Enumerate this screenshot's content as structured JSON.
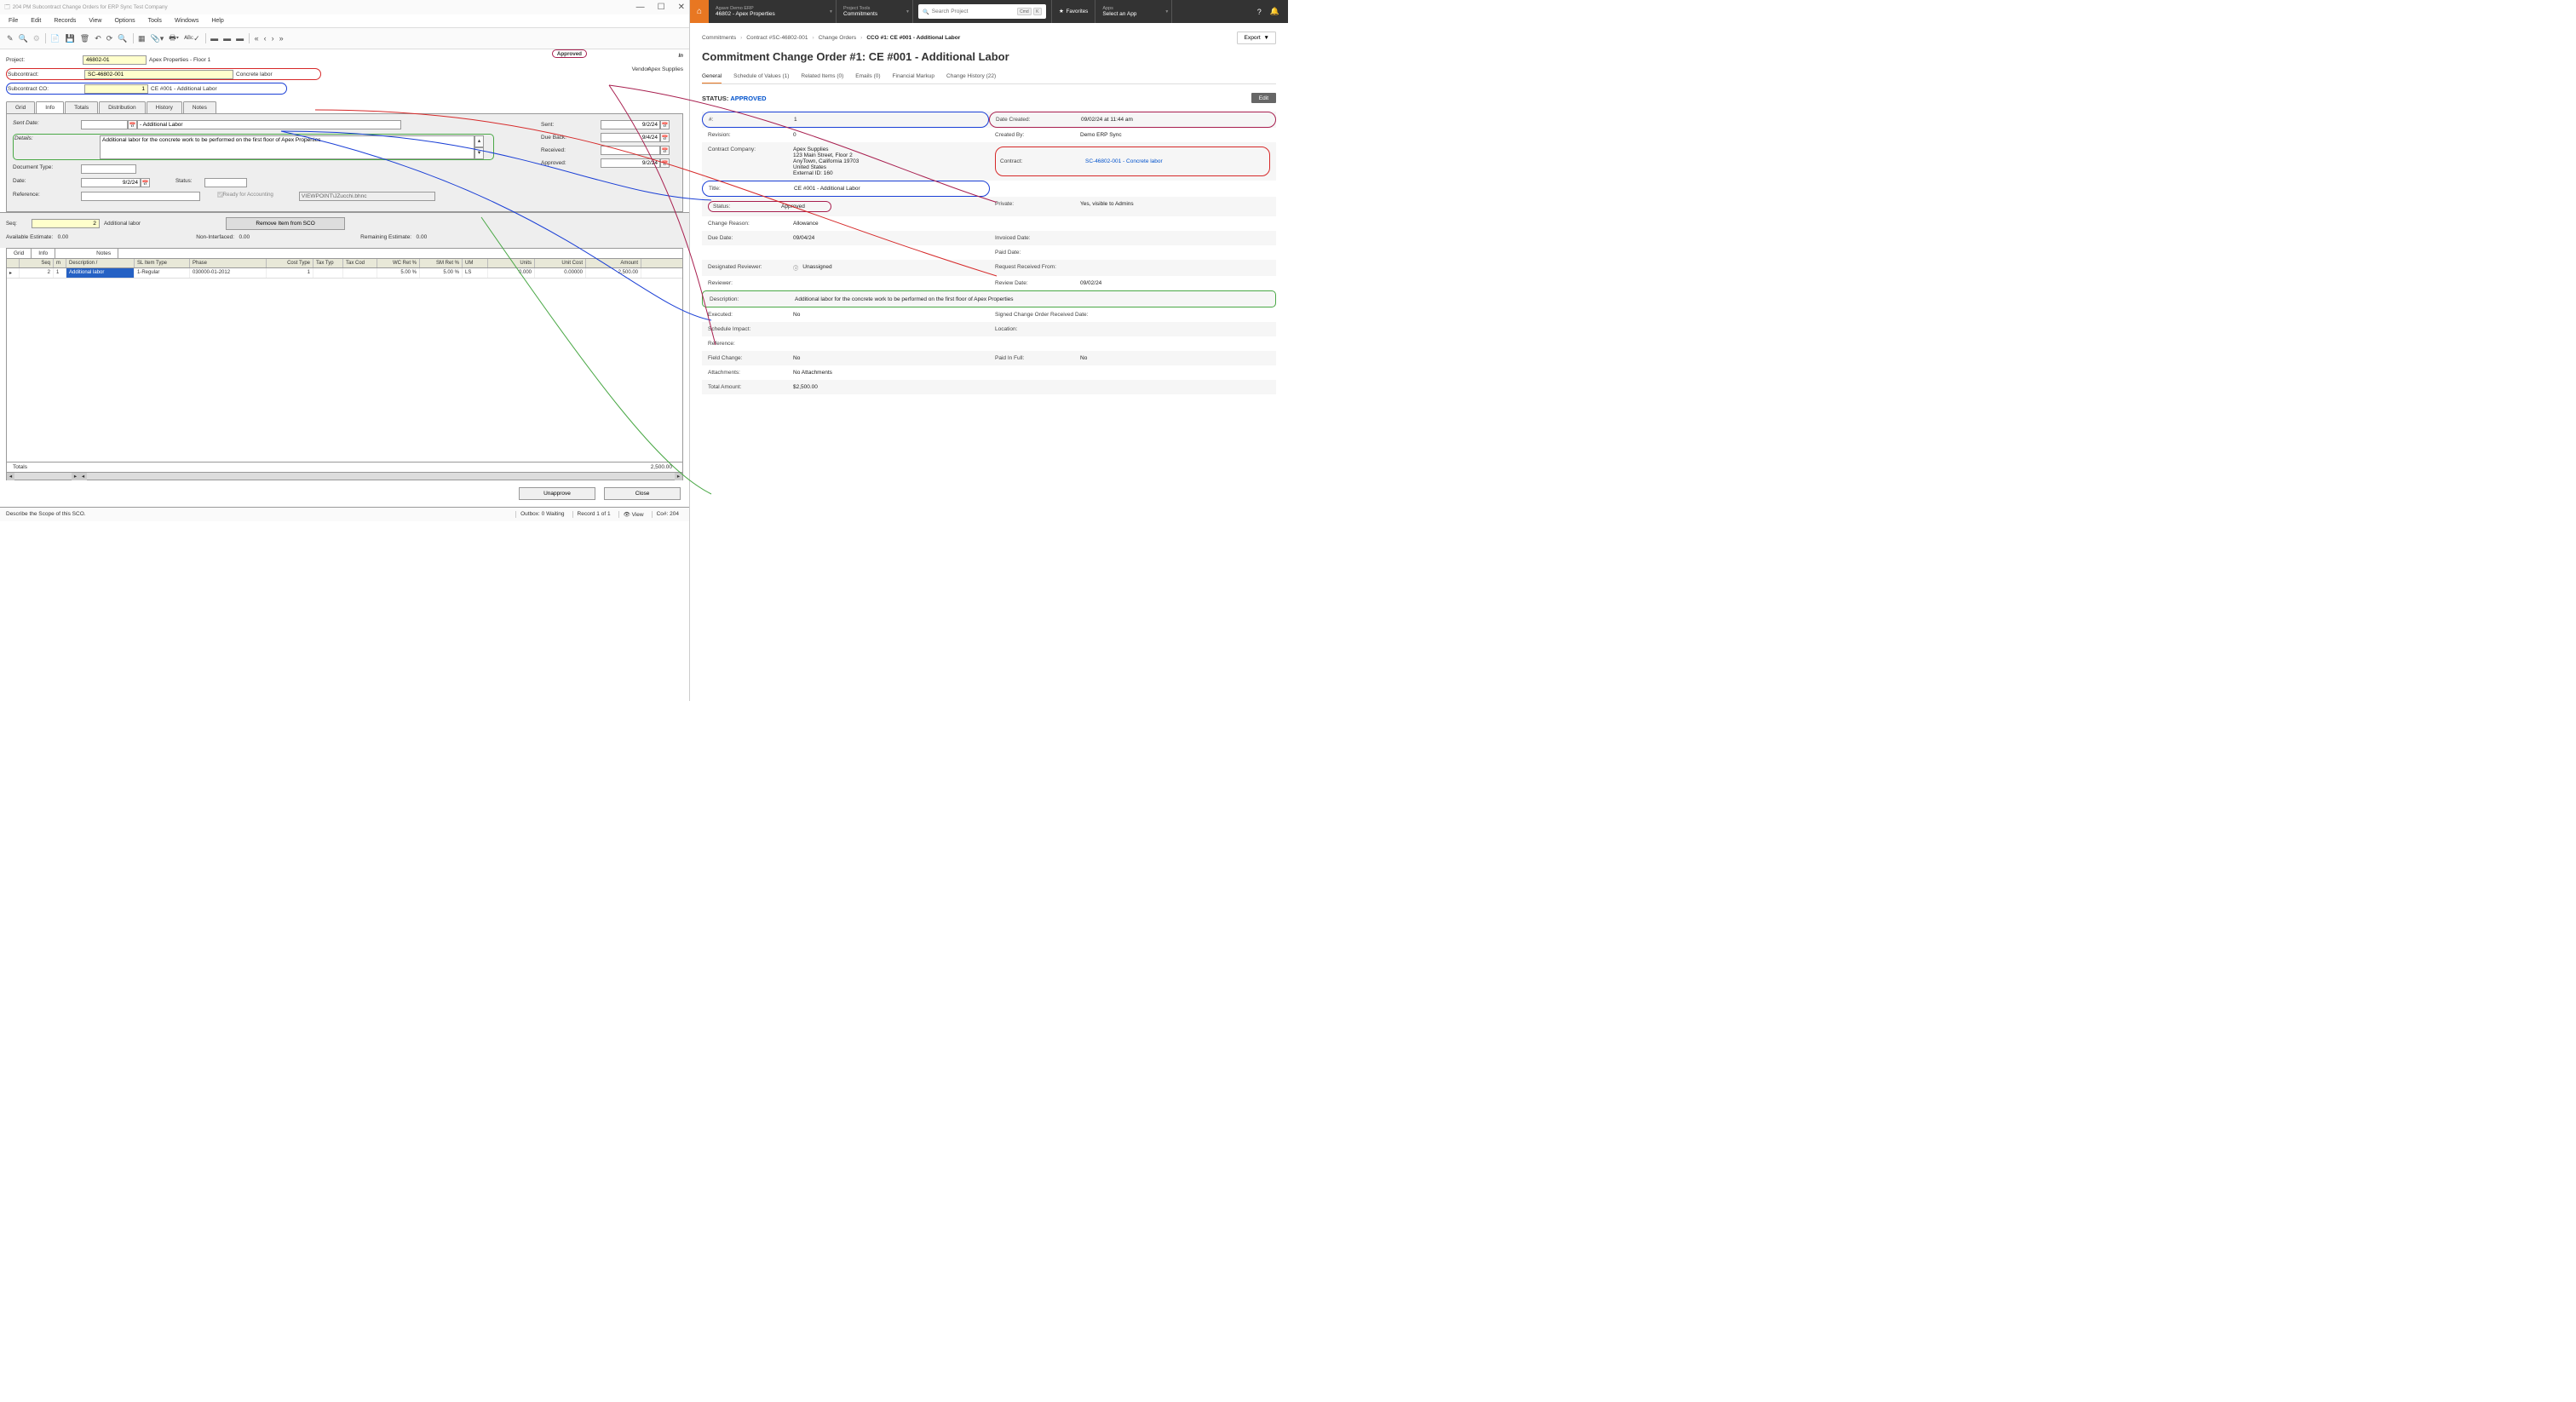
{
  "erp": {
    "window_title": "204 PM Subcontract Change Orders for ERP Sync Test Company",
    "menus": [
      "File",
      "Edit",
      "Records",
      "View",
      "Options",
      "Tools",
      "Windows",
      "Help"
    ],
    "approved_badge": "Approved",
    "invoice_label": "In",
    "header": {
      "project_label": "Project:",
      "project_num": "46802-01",
      "project_name": "Apex Properties - Floor 1",
      "subcontract_label": "Subcontract:",
      "subcontract_num": "SC-46802-001",
      "subcontract_name": "Concrete labor",
      "sco_label": "Subcontract CO:",
      "sco_num": "1",
      "sco_name": "CE #001 - Additional Labor",
      "vendor_label": "Vendor:",
      "vendor_name": "Apex Supplies"
    },
    "tabs": [
      "Grid",
      "Info",
      "Totals",
      "Distribution",
      "History",
      "Notes"
    ],
    "active_tab": "Info",
    "info": {
      "sent_date_label": "Sent Date:",
      "sent_date_val": "",
      "sent_date_desc": "- Additional Labor",
      "details_label": "Details:",
      "details_text": "Additional labor for the concrete work to be performed on the first floor of Apex Properties",
      "doc_type_label": "Document Type:",
      "date_label": "Date:",
      "date_val": "9/2/24",
      "status_label": "Status:",
      "reference_label": "Reference:",
      "ready_label": " Ready for Accounting",
      "path_val": "VIEWPOINT\\JZucchi.bhnc",
      "sent_row_label": "Sent:",
      "sent_row_val": "9/2/24",
      "due_back_label": "Due Back:",
      "due_back_val": "9/4/24",
      "received_label": "Received:",
      "received_val": "",
      "approved_label": "Approved:",
      "approved_val": "9/2/24"
    },
    "seq": {
      "label": "Seq:",
      "val": "2",
      "desc": "Additional labor",
      "remove_btn": "Remove Item from SCO",
      "avail_est_label": "Available Estimate:",
      "avail_est_val": "0.00",
      "non_int_label": "Non-Interfaced:",
      "non_int_val": "0.00",
      "rem_est_label": "Remaining Estimate:",
      "rem_est_val": "0.00"
    },
    "sub_tabs": [
      "Grid",
      "Info",
      "Notes"
    ],
    "active_sub_tab": "Grid",
    "grid_headers": [
      "Seq",
      "m",
      "Description  /",
      "SL Item Type",
      "Phase",
      "Cost Type",
      "Tax Typ",
      "Tax Cod",
      "WC Ret %",
      "SM Ret %",
      "UM",
      "Units",
      "Unit Cost",
      "Amount"
    ],
    "grid_row": {
      "seq": "2",
      "m": "1",
      "desc": "Additional labor",
      "sl_type": "1-Regular",
      "phase": "030000-01-2012",
      "cost_type": "1",
      "tax_typ": "",
      "tax_cod": "",
      "wc_ret": "5.00 %",
      "sm_ret": "5.00 %",
      "um": "LS",
      "units": "0.000",
      "unit_cost": "0.00000",
      "amount": "2,500.00"
    },
    "totals_label": "Totals",
    "totals_amount": "2,500.00",
    "unapprove_btn": "Unapprove",
    "close_btn": "Close",
    "status_bar": {
      "left": "Describe the Scope of this SCO.",
      "outbox": "Outbox: 0 Waiting",
      "record": "Record 1 of 1",
      "view": "View",
      "co": "Co#: 204"
    }
  },
  "web": {
    "header": {
      "erp_sub": "Agave Demo ERP",
      "erp_main": "46802 - Apex Properties",
      "tools_sub": "Project Tools",
      "tools_main": "Commitments",
      "search_placeholder": "Search Project",
      "kbd1": "Cmd",
      "kbd2": "K",
      "fav_label": "Favorites",
      "apps_sub": "Apps",
      "apps_main": "Select an App"
    },
    "breadcrumb": {
      "l1": "Commitments",
      "l2": "Contract #SC-46802-001",
      "l3": "Change Orders",
      "l4": "CCO #1: CE #001 - Additional Labor"
    },
    "export_btn": "Export",
    "page_title": "Commitment Change Order #1: CE #001 - Additional Labor",
    "tabs": [
      "General",
      "Schedule of Values (1)",
      "Related Items (0)",
      "Emails (0)",
      "Financial Markup",
      "Change History (22)"
    ],
    "active_tab": "General",
    "status_label": "STATUS:",
    "status_val": "APPROVED",
    "edit_btn": "Edit",
    "details": {
      "number_label": "#:",
      "number_val": "1",
      "date_created_label": "Date Created:",
      "date_created_val": "09/02/24 at 11:44 am",
      "revision_label": "Revision:",
      "revision_val": "0",
      "created_by_label": "Created By:",
      "created_by_val": "Demo ERP Sync",
      "company_label": "Contract Company:",
      "company_val": "Apex Supplies\n123 Main Street, Floor 2\nAnyTown, California 19703\nUnited States\nExternal ID: 160",
      "contract_label": "Contract:",
      "contract_val": "SC-46802-001 - Concrete labor",
      "title_label": "Title:",
      "title_val": "CE #001 - Additional Labor",
      "status_label": "Status:",
      "status_val": "Approved",
      "private_label": "Private:",
      "private_val": "Yes, visible to Admins",
      "reason_label": "Change Reason:",
      "reason_val": "Allowance",
      "due_label": "Due Date:",
      "due_val": "09/04/24",
      "invoiced_label": "Invoiced Date:",
      "paid_date_label": "Paid Date:",
      "reviewer_label": "Designated Reviewer:",
      "reviewer_val": "Unassigned",
      "req_from_label": "Request Received From:",
      "reviewer2_label": "Reviewer:",
      "review_date_label": "Review Date:",
      "review_date_val": "09/02/24",
      "desc_label": "Description:",
      "desc_val": "Additional labor for the concrete work to be performed on the first floor of Apex Properties",
      "executed_label": "Executed:",
      "executed_val": "No",
      "signed_label": "Signed Change Order Received Date:",
      "sched_label": "Schedule Impact:",
      "location_label": "Location:",
      "ref_label": "Reference:",
      "fc_label": "Field Change:",
      "fc_val": "No",
      "paid_full_label": "Paid In Full:",
      "paid_full_val": "No",
      "attach_label": "Attachments:",
      "attach_val": "No Attachments",
      "total_label": "Total Amount:",
      "total_val": "$2,500.00"
    }
  }
}
